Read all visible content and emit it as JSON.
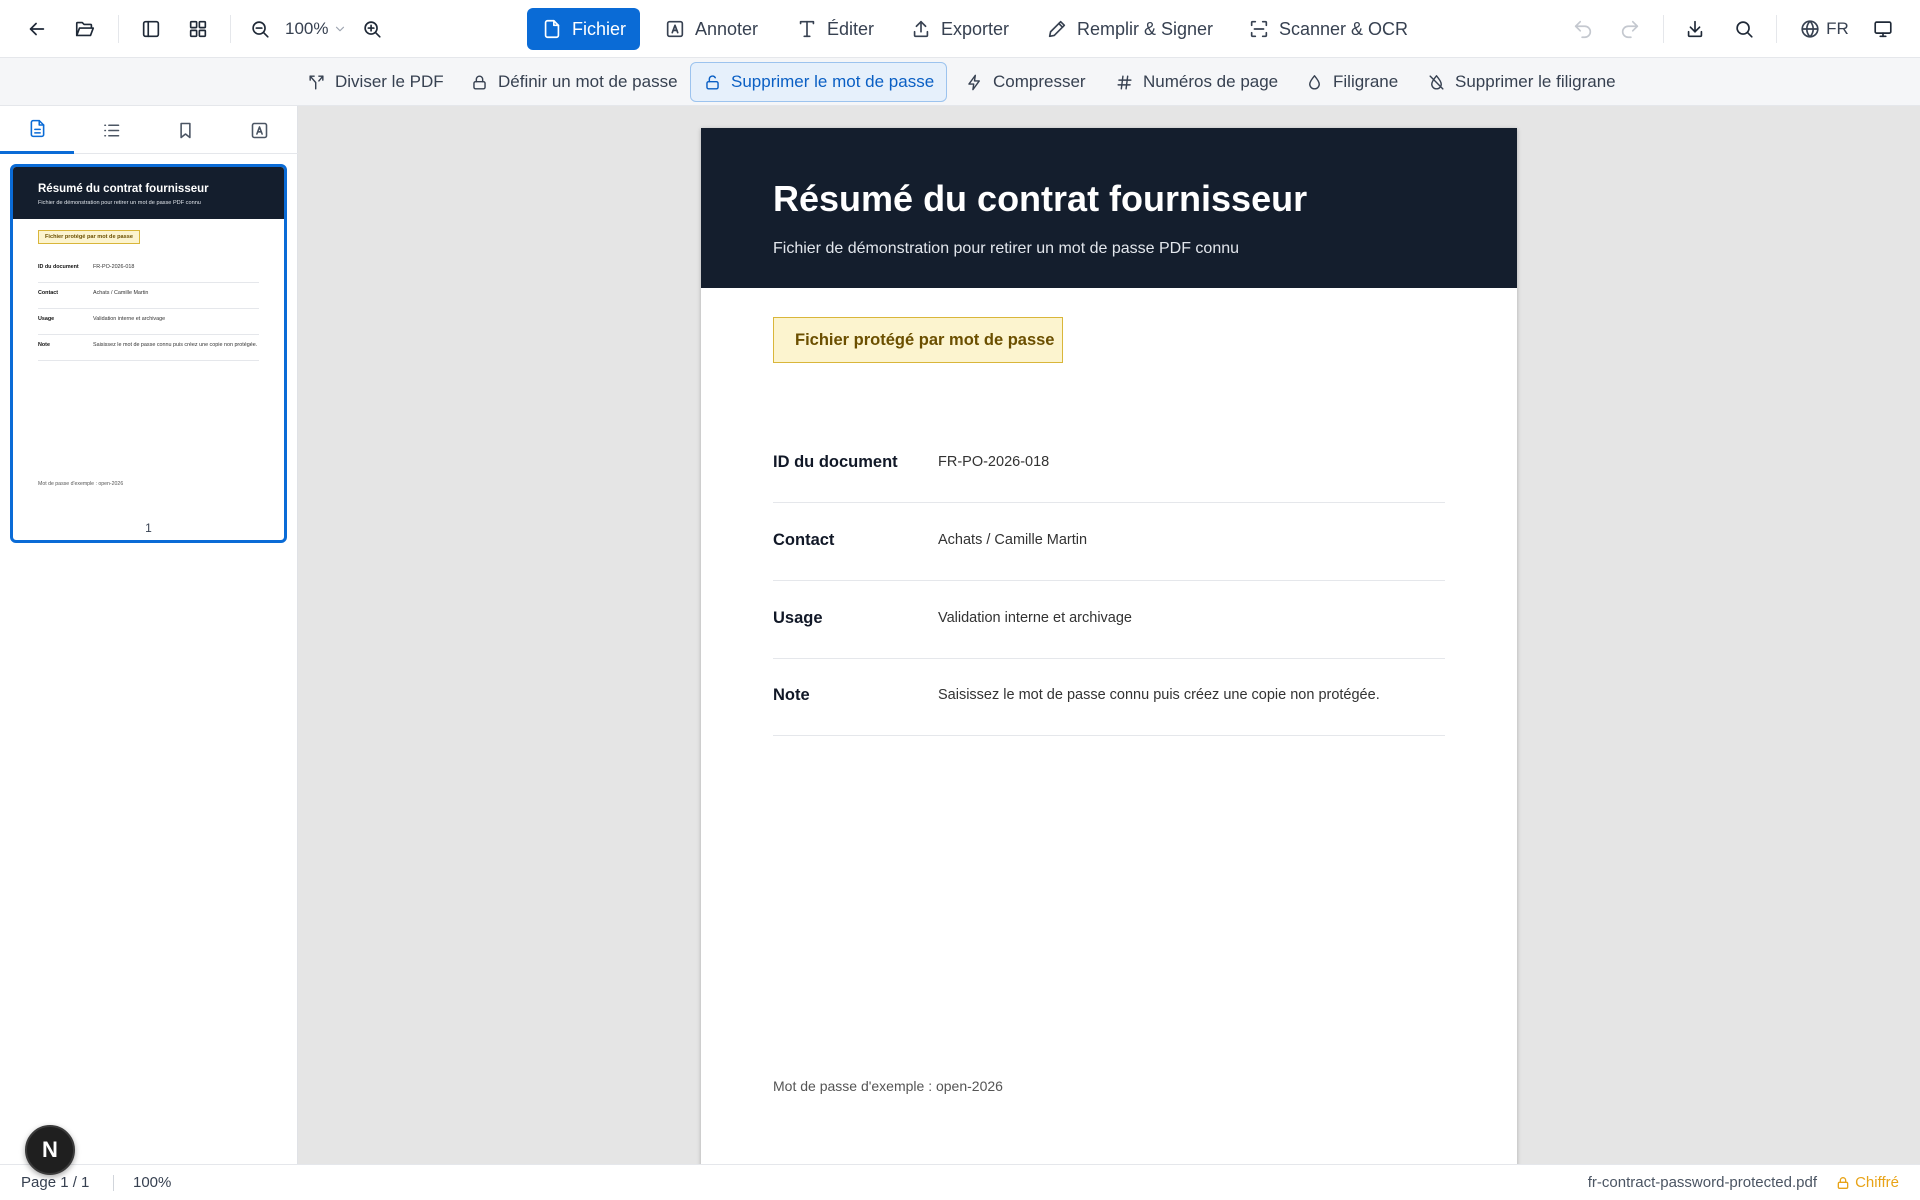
{
  "toolbar": {
    "zoom_value": "100%",
    "tabs": [
      {
        "label": "Fichier",
        "icon": "file-icon"
      },
      {
        "label": "Annoter",
        "icon": "text-box-icon"
      },
      {
        "label": "Éditer",
        "icon": "type-icon"
      },
      {
        "label": "Exporter",
        "icon": "upload-icon"
      },
      {
        "label": "Remplir & Signer",
        "icon": "pen-icon"
      },
      {
        "label": "Scanner & OCR",
        "icon": "scan-icon"
      }
    ],
    "language": "FR"
  },
  "subtoolbar": {
    "items": [
      {
        "label": "Diviser le PDF",
        "icon": "split-icon"
      },
      {
        "label": "Définir un mot de passe",
        "icon": "lock-icon"
      },
      {
        "label": "Supprimer le mot de passe",
        "icon": "unlock-icon"
      },
      {
        "label": "Compresser",
        "icon": "bolt-icon"
      },
      {
        "label": "Numéros de page",
        "icon": "hash-icon"
      },
      {
        "label": "Filigrane",
        "icon": "droplet-icon"
      },
      {
        "label": "Supprimer le filigrane",
        "icon": "droplet-off-icon"
      }
    ],
    "active_index": 2
  },
  "sidebar": {
    "tabs": [
      "page-thumbnails-icon",
      "outline-list-icon",
      "bookmark-icon",
      "annotation-box-icon"
    ],
    "thumbnail_page_number": "1"
  },
  "document": {
    "title": "Résumé du contrat fournisseur",
    "subtitle": "Fichier de démonstration pour retirer un mot de passe PDF connu",
    "badge": "Fichier protégé par mot de passe",
    "rows": [
      {
        "label": "ID du document",
        "value": "FR-PO-2026-018"
      },
      {
        "label": "Contact",
        "value": "Achats / Camille Martin"
      },
      {
        "label": "Usage",
        "value": "Validation interne et archivage"
      },
      {
        "label": "Note",
        "value": "Saisissez le mot de passe connu puis créez une copie non protégée."
      }
    ],
    "footer": "Mot de passe d'exemple : open-2026"
  },
  "statusbar": {
    "page_info": "Page 1 / 1",
    "zoom": "100%",
    "filename": "fr-contract-password-protected.pdf",
    "encryption": "Chiffré"
  },
  "avatar_letter": "N",
  "colors": {
    "accent": "#0a6bd6",
    "header_dark": "#141e2d",
    "badge_bg": "#fcf4cf",
    "badge_border": "#d9b63a",
    "encrypted": "#e8a317"
  }
}
